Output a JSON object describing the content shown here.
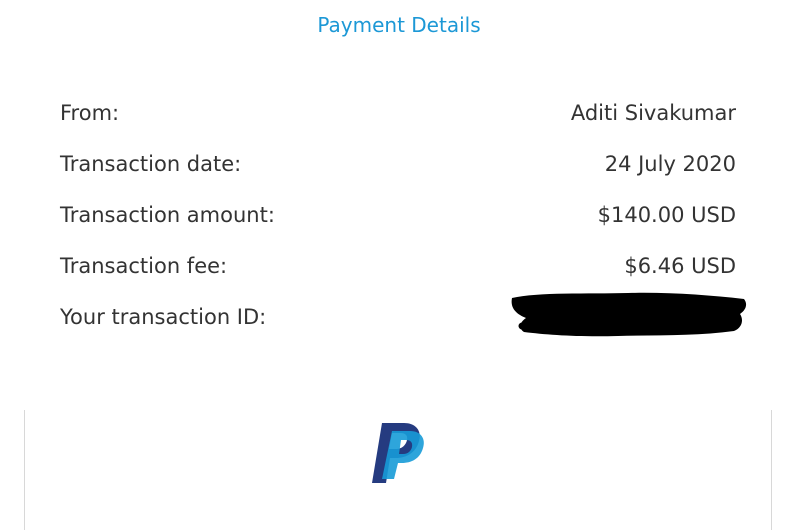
{
  "header": {
    "title": "Payment Details"
  },
  "details": [
    {
      "label": "From:",
      "value": "Aditi Sivakumar"
    },
    {
      "label": "Transaction date:",
      "value": "24 July 2020"
    },
    {
      "label": "Transaction amount:",
      "value": "$140.00 USD"
    },
    {
      "label": "Transaction fee:",
      "value": "$6.46 USD"
    },
    {
      "label": "Your transaction ID:",
      "value": ""
    }
  ],
  "colors": {
    "title": "#1c98d6",
    "text": "#333333",
    "logo_dark": "#253b80",
    "logo_light": "#179bd7",
    "redaction": "#000000"
  },
  "icons": {
    "logo": "paypal-logo"
  }
}
